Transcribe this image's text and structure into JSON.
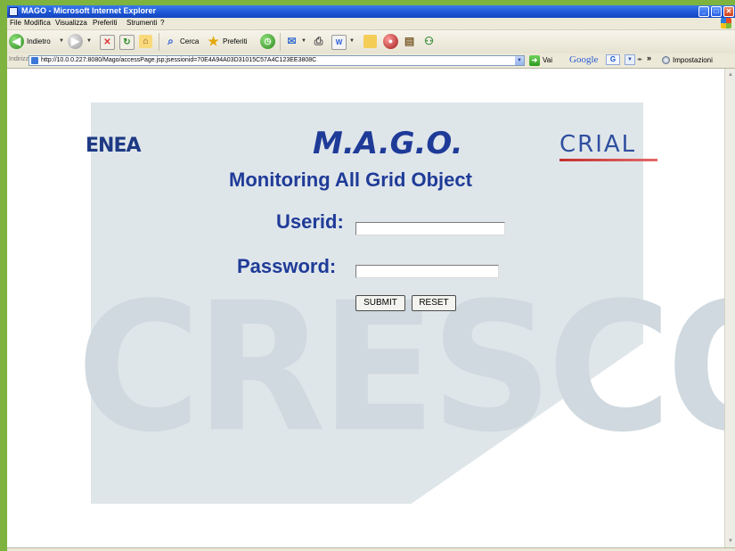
{
  "window": {
    "title": "MAGO - Microsoft Internet Explorer",
    "controls": [
      "_",
      "□",
      "✕"
    ]
  },
  "menu": {
    "items": [
      "File",
      "Modifica",
      "Visualizza",
      "Preferiti",
      "Strumenti",
      "?"
    ]
  },
  "toolbar": {
    "back_label": "Indietro",
    "search_label": "Cerca",
    "favorites_label": "Preferiti"
  },
  "address": {
    "label": "Indirizzo",
    "url": "http://10.0.0.227:8080/Mago/accessPage.jsp;jsessionid=70E4A94A03D31015C57A4C123EE3808C",
    "go_label": "Vai",
    "google_logo": "Google",
    "google_button": "G",
    "settings_label": "Impostazioni"
  },
  "page": {
    "enea_logo": "ENEA",
    "crial_logo": "CRIAL",
    "title": "M.A.G.O.",
    "subtitle": "Monitoring All Grid Object",
    "watermark": "CRESCO",
    "userid_label": "Userid:",
    "userid_value": "",
    "password_label": "Password:",
    "password_value": "",
    "submit_label": "SUBMIT",
    "reset_label": "RESET"
  },
  "colors": {
    "accent": "#1f3b98",
    "desktop": "#7db33e",
    "titlebar": "#1d54d4"
  }
}
